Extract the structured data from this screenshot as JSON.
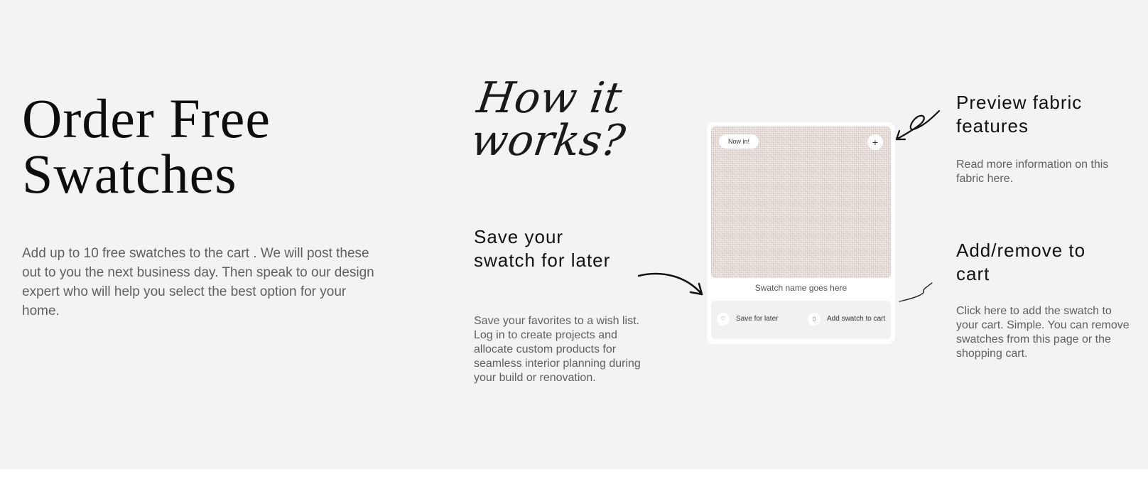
{
  "hero": {
    "title": "Order Free Swatches",
    "intro": "Add up to 10 free swatches to the cart . We will post these out to you the next business day. Then speak to our design expert who will help you select the best option for your home."
  },
  "how": {
    "title": "How it works?"
  },
  "features": {
    "save": {
      "heading": "Save your swatch for later",
      "text": "Save your favorites to a wish list. Log in to create projects and allocate custom products for seamless interior planning during your build or renovation."
    },
    "preview": {
      "heading": "Preview fabric features",
      "text": "Read more information on this fabric here."
    },
    "cart": {
      "heading": "Add/remove to cart",
      "text": "Click here to add the swatch to your cart. Simple. You can remove swatches from this page or the shopping cart."
    }
  },
  "card": {
    "badge": "Now in!",
    "plus_icon": "+",
    "swatch_name": "Swatch name goes here",
    "save_label": "Save for later",
    "add_label": "Add swatch to cart",
    "heart_icon": "♡",
    "bag_icon": "▯"
  },
  "colors": {
    "background": "#f3f3f3",
    "card": "#ffffff",
    "fabric": "#e9dfdb"
  }
}
